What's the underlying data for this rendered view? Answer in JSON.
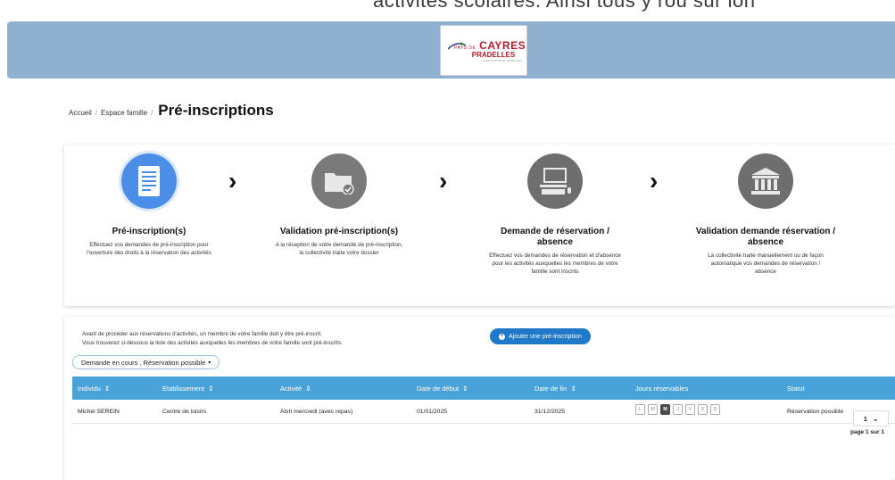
{
  "top_text": "activités scolaires. Ainsi tous y rou sur ion",
  "logo": {
    "line1_prefix": "PAYS DE",
    "line1": "CAYRES",
    "line2": "PRADELLES",
    "line3": "COMMUNAUTÉ DE COMMUNES"
  },
  "breadcrumb": {
    "home": "Accueil",
    "family": "Espace famille",
    "current": "Pré-inscriptions",
    "separator": "/"
  },
  "steps": [
    {
      "title": "Pré-inscription(s)",
      "desc": "Effectuez vos demandes de pré-inscription pour l'ouverture des droits à la réservation des activités",
      "icon": "document-icon"
    },
    {
      "title": "Validation pré-inscription(s)",
      "desc": "A la réception de votre demande de pré-inscription, la collectivité traite votre dossier",
      "icon": "folder-check-icon"
    },
    {
      "title": "Demande de réservation / absence",
      "desc": "Effectuez vos demandes de réservation et d'absence pour les activités auxquelles les membres de votre famille sont inscrits",
      "icon": "computer-icon"
    },
    {
      "title": "Validation demande réservation / absence",
      "desc": "La collectivité traite manuellement ou de façon automatique vos demandes de réservation / absence",
      "icon": "building-icon"
    }
  ],
  "intro": {
    "line1": "Avant de procéder aux réservations d'activités, un membre de votre famille doit y être pré-inscrit.",
    "line2": "Vous trouverez ci-dessous la liste des activités auxquelles les membres de votre famille sont pré-inscrits."
  },
  "add_button": "Ajouter une pré-inscription",
  "filter_label": "Demande en cours , Réservation possible",
  "table": {
    "headers": [
      "Individu",
      "Etablissement",
      "Activité",
      "Date de début",
      "Date de fin",
      "Jours réservables",
      "Statut"
    ],
    "rows": [
      {
        "individu": "Michel SEREIN",
        "etablissement": "Centre de loisirs",
        "activite": "Alsh mercredi (avec repas)",
        "debut": "01/01/2025",
        "fin": "31/12/2025",
        "statut": "Réservation possible"
      }
    ],
    "days": [
      "L",
      "M",
      "M",
      "J",
      "V",
      "S",
      "D"
    ]
  },
  "pager": {
    "value": "1",
    "text": "page 1 sur 1"
  },
  "colors": {
    "header": "#8fb1cf",
    "table_header": "#4aa3d8",
    "button": "#1f78c8",
    "step1": "#4b8ee8",
    "step_gray": "#7a7a7a"
  }
}
